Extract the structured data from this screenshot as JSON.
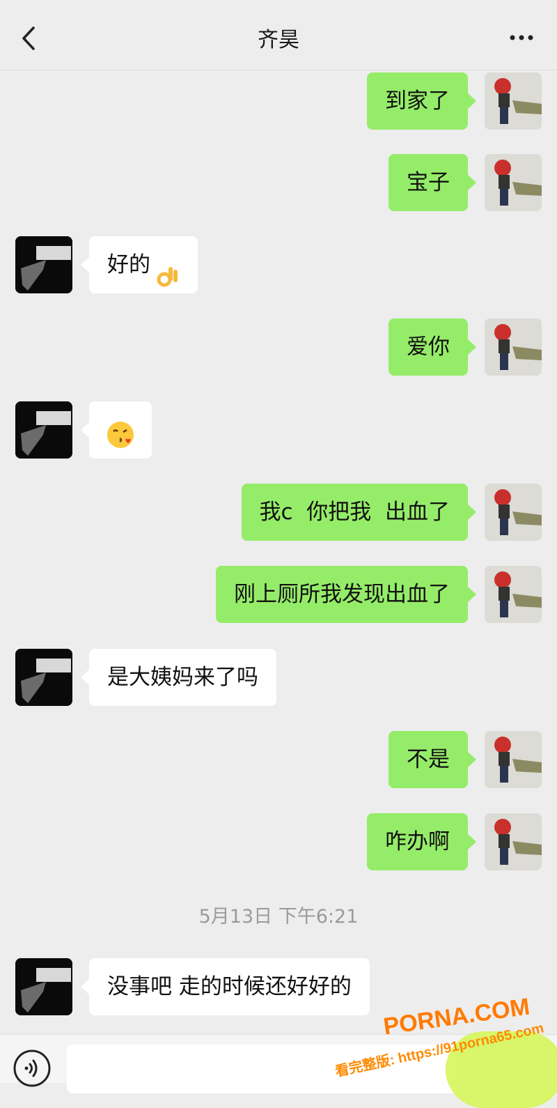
{
  "header": {
    "title": "齐昊"
  },
  "messages": [
    {
      "side": "me",
      "text": "到家了"
    },
    {
      "side": "me",
      "text": "宝子"
    },
    {
      "side": "friend",
      "text": "好的"
    },
    {
      "side": "me",
      "text": "爱你"
    },
    {
      "side": "friend",
      "text": ""
    },
    {
      "side": "me",
      "text": "我c  你把我  出血了"
    },
    {
      "side": "me",
      "text": "刚上厕所我发现出血了"
    },
    {
      "side": "friend",
      "text": "是大姨妈来了吗"
    },
    {
      "side": "me",
      "text": "不是"
    },
    {
      "side": "me",
      "text": "咋办啊"
    },
    {
      "side": "friend",
      "text": "没事吧 走的时候还好好的"
    }
  ],
  "timestamp": "5月13日 下午6:21",
  "watermark": {
    "logo": "PORNA.COM",
    "url": "看完整版: https://91porna65.com"
  },
  "icons": {
    "back": "chevron-left-icon",
    "more": "more-dots-icon",
    "voice": "voice-icon",
    "ok_emoji": "ok-hand-emoji",
    "kiss_emoji": "kiss-emoji"
  },
  "colors": {
    "background": "#ededed",
    "my_bubble": "#95ec69",
    "friend_bubble": "#ffffff"
  }
}
